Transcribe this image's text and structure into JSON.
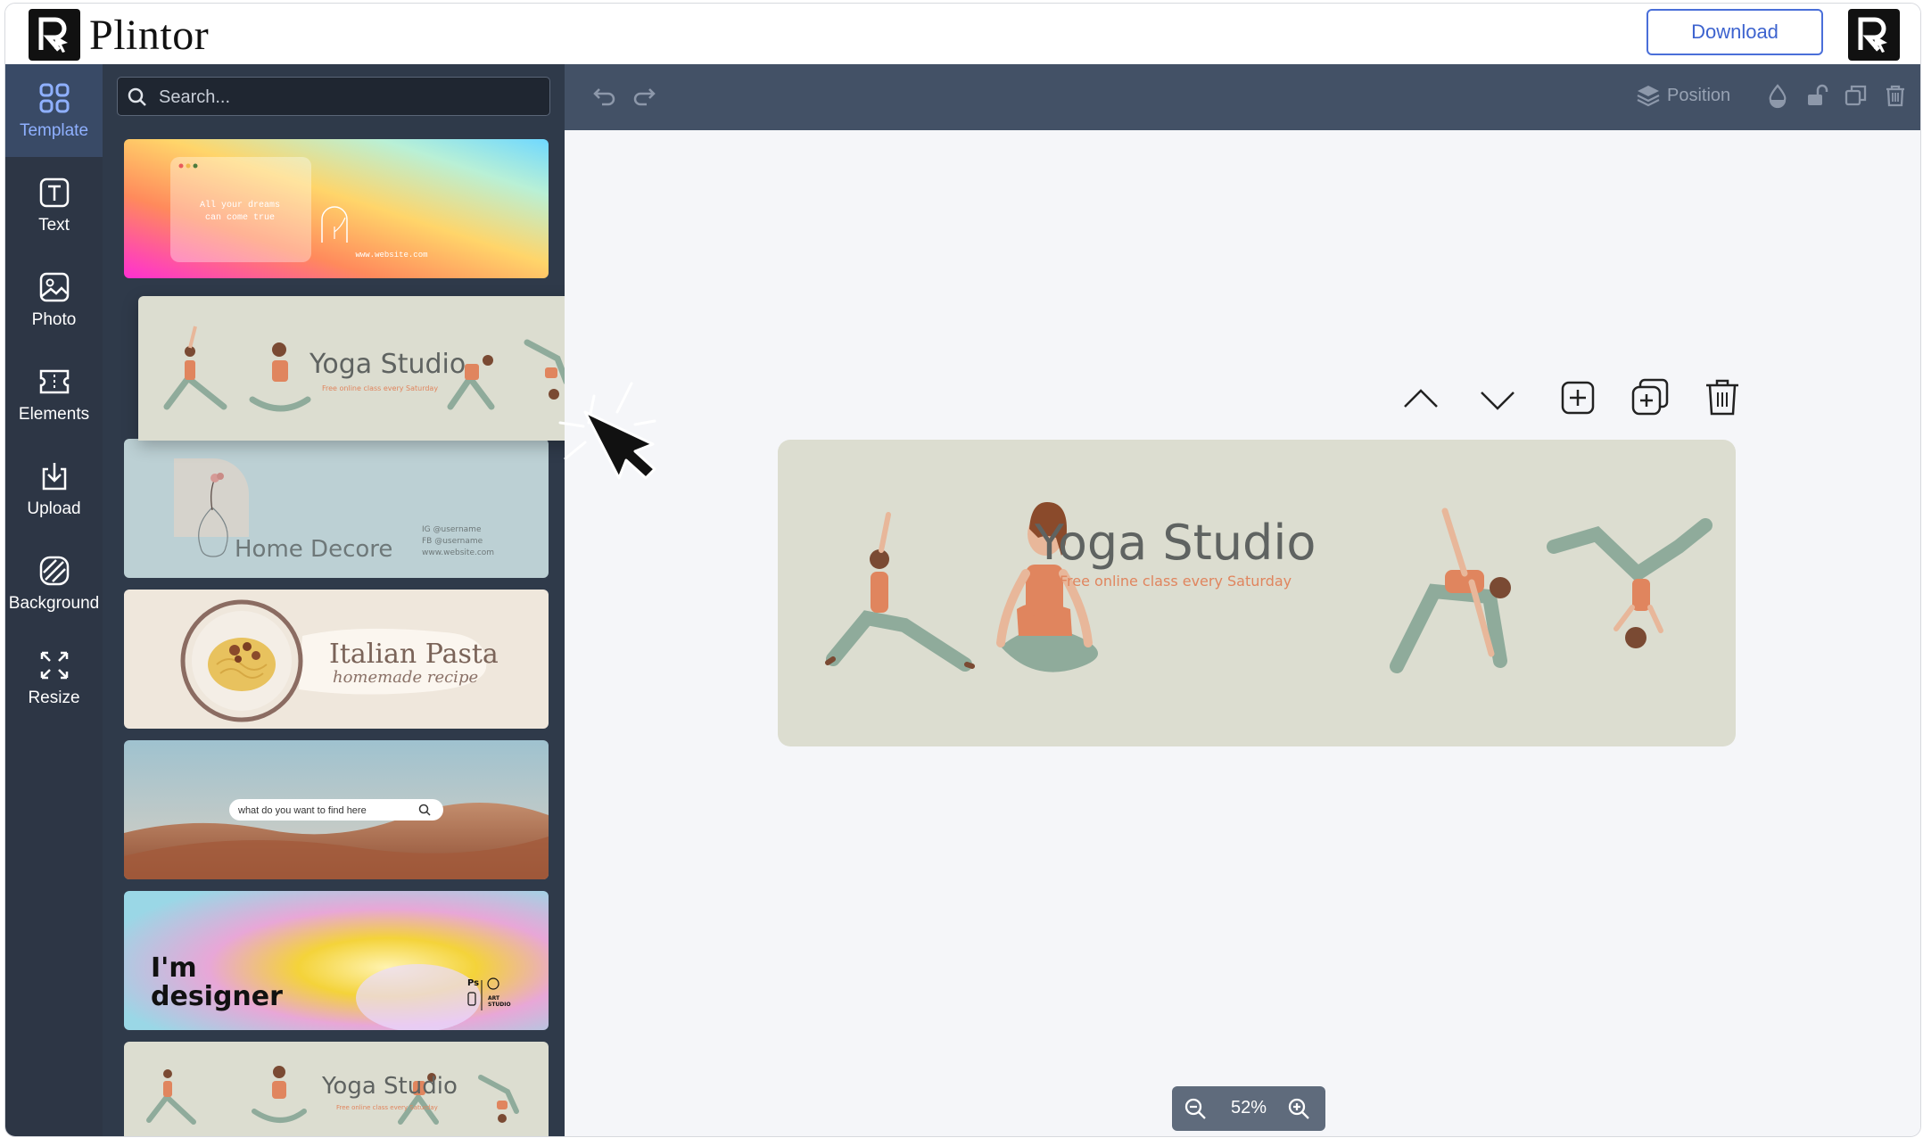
{
  "app": {
    "name": "Plintor"
  },
  "header": {
    "download_label": "Download"
  },
  "rail": [
    {
      "key": "template",
      "label": "Template",
      "icon": "grid-icon",
      "active": true
    },
    {
      "key": "text",
      "label": "Text",
      "icon": "text-icon",
      "active": false
    },
    {
      "key": "photo",
      "label": "Photo",
      "icon": "image-icon",
      "active": false
    },
    {
      "key": "elements",
      "label": "Elements",
      "icon": "elements-icon",
      "active": false
    },
    {
      "key": "upload",
      "label": "Upload",
      "icon": "upload-icon",
      "active": false
    },
    {
      "key": "background",
      "label": "Background",
      "icon": "background-icon",
      "active": false
    },
    {
      "key": "resize",
      "label": "Resize",
      "icon": "resize-icon",
      "active": false
    }
  ],
  "search": {
    "placeholder": "Search..."
  },
  "templates": {
    "gradient": {
      "line1": "All your dreams",
      "line2": "can come true",
      "url": "www.website.com"
    },
    "yoga_hover": {
      "title": "Yoga Studio",
      "subtitle": "Free online class every Saturday"
    },
    "home_decore": {
      "title": "Home Decore",
      "ig": "IG @username",
      "fb": "FB @username",
      "url": "www.website.com"
    },
    "pasta": {
      "title": "Italian Pasta",
      "subtitle": "homemade recipe"
    },
    "desert": {
      "search_text": "what do you want to find here"
    },
    "designer": {
      "line1": "I'm",
      "line2": "designer",
      "ps": "Ps",
      "art": "ART",
      "studio": "STUDIO"
    },
    "yoga_bottom": {
      "title": "Yoga Studio",
      "subtitle": "Free online class every Saturday"
    }
  },
  "toolbar": {
    "position_label": "Position"
  },
  "canvas": {
    "title": "Yoga Studio",
    "subtitle": "Free online class every Saturday"
  },
  "zoom": {
    "value": "52%"
  },
  "colors": {
    "rail_bg": "#2d3645",
    "panel_bg": "#2f3a4a",
    "toolbar_bg": "#435166",
    "accent": "#4a6fd9",
    "design_bg": "#dcddd0",
    "yoga_green": "#8fab9b",
    "yoga_orange": "#e0855e"
  }
}
